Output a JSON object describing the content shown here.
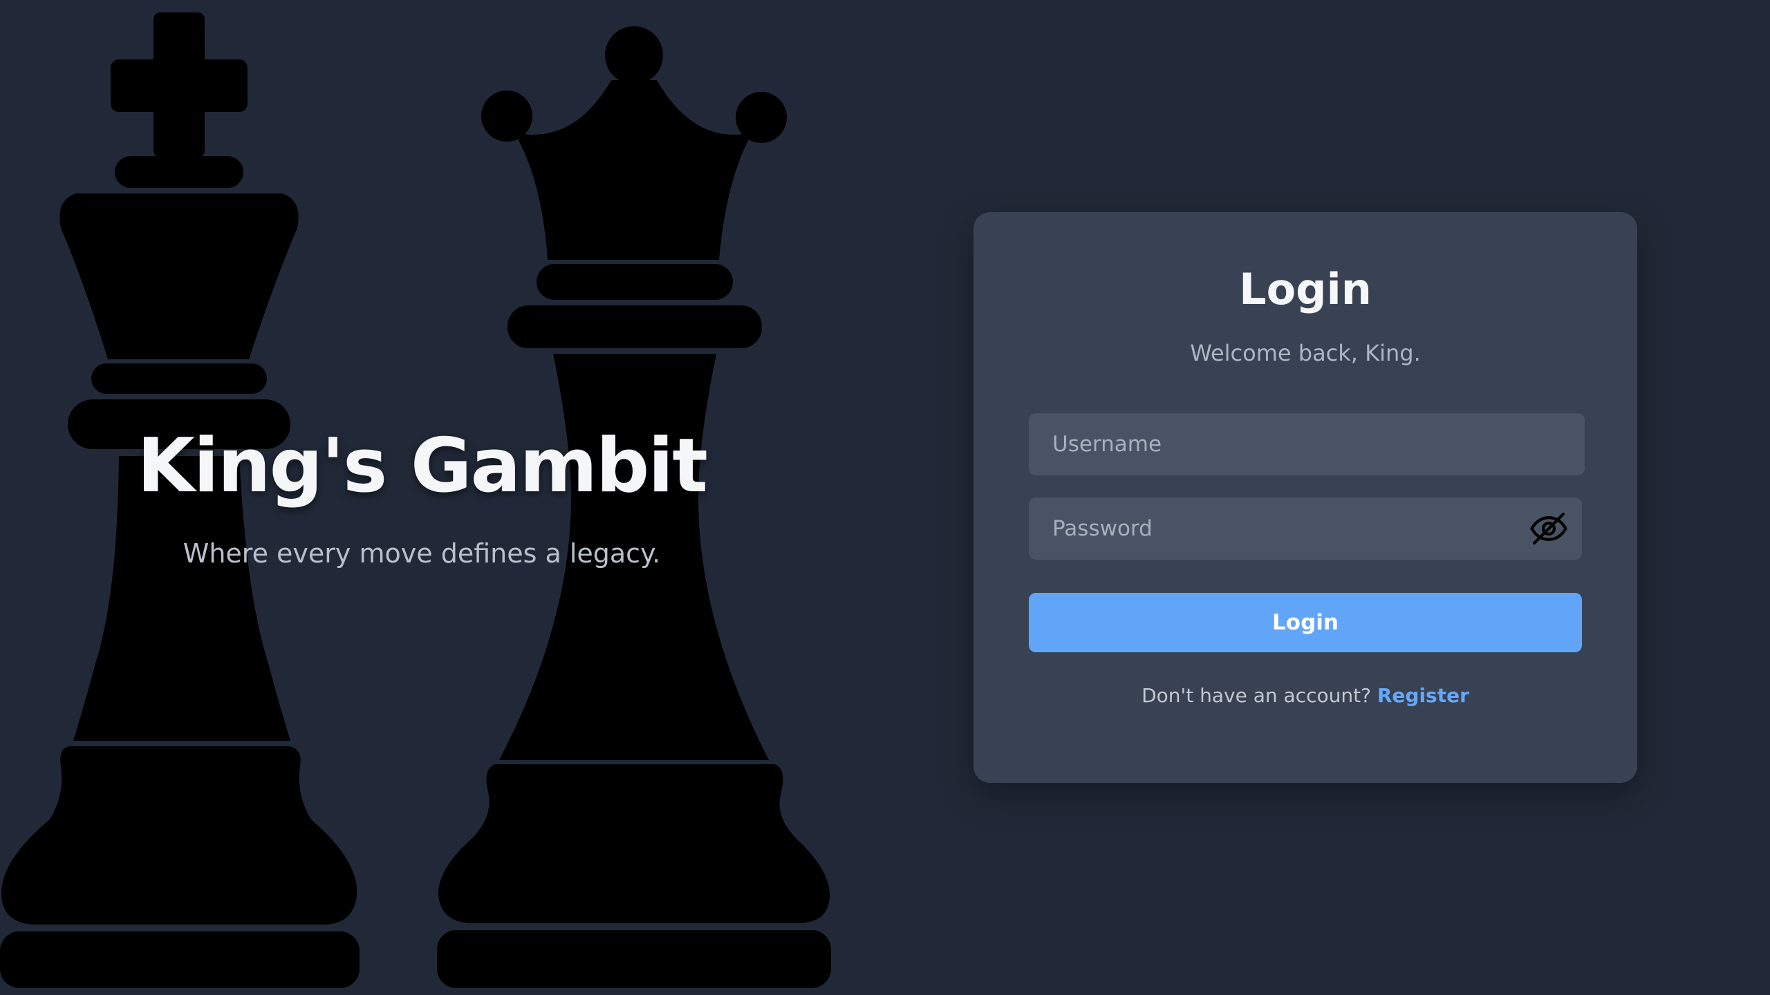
{
  "hero": {
    "title": "King's Gambit",
    "subtitle": "Where every move defines a legacy."
  },
  "login_card": {
    "title": "Login",
    "subtitle": "Welcome back, King.",
    "username_placeholder": "Username",
    "password_placeholder": "Password",
    "submit_label": "Login",
    "register_prompt": "Don't have an account?",
    "register_link": "Register"
  },
  "icons": {
    "background_left": "chess-king-icon",
    "background_right": "chess-queen-icon",
    "password_toggle": "eye-slash-icon"
  },
  "colors": {
    "background": "#212938",
    "card": "#384253",
    "input": "#4a5363",
    "accent": "#61a5f8",
    "pieces": "#000000"
  }
}
